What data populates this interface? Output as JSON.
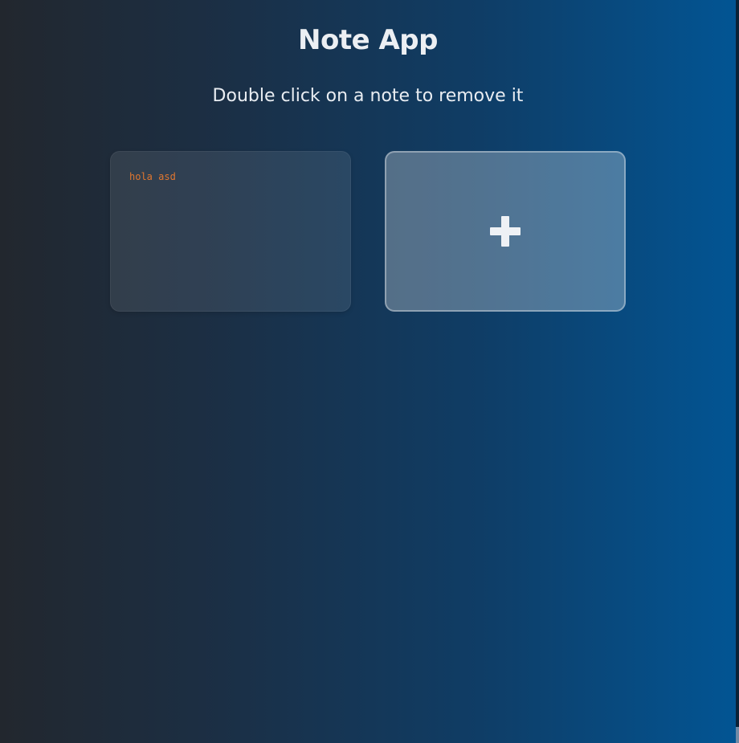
{
  "app": {
    "title": "Note App",
    "subtitle": "Double click on a note to remove it"
  },
  "notes": [
    {
      "text": "hola asd"
    }
  ],
  "add_button": {
    "icon": "plus-icon",
    "label": "+"
  },
  "colors": {
    "note_text": "#e0762f",
    "gradient_start": "#22272e",
    "gradient_end": "#025594"
  }
}
